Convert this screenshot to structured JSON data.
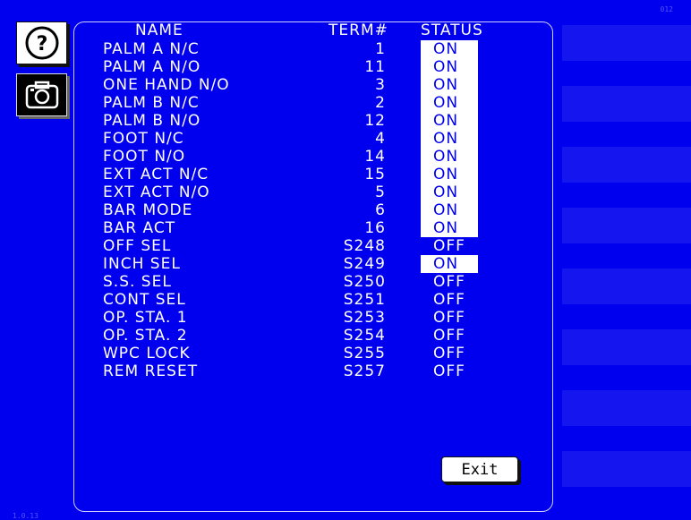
{
  "header": {
    "name": "NAME",
    "term": "TERM#",
    "status": "STATUS"
  },
  "rows": [
    {
      "name": "PALM A N/C",
      "term": "1",
      "status": "ON"
    },
    {
      "name": "PALM A N/O",
      "term": "11",
      "status": "ON"
    },
    {
      "name": "ONE HAND N/O",
      "term": "3",
      "status": "ON"
    },
    {
      "name": "PALM B N/C",
      "term": "2",
      "status": "ON"
    },
    {
      "name": "PALM B N/O",
      "term": "12",
      "status": "ON"
    },
    {
      "name": "FOOT N/C",
      "term": "4",
      "status": "ON"
    },
    {
      "name": "FOOT N/O",
      "term": "14",
      "status": "ON"
    },
    {
      "name": "EXT ACT N/C",
      "term": "15",
      "status": "ON"
    },
    {
      "name": "EXT ACT N/O",
      "term": "5",
      "status": "ON"
    },
    {
      "name": "BAR MODE",
      "term": "6",
      "status": "ON"
    },
    {
      "name": "BAR ACT",
      "term": "16",
      "status": "ON"
    },
    {
      "name": "OFF SEL",
      "term": "S248",
      "status": "OFF"
    },
    {
      "name": "INCH SEL",
      "term": "S249",
      "status": "ON"
    },
    {
      "name": "S.S. SEL",
      "term": "S250",
      "status": "OFF"
    },
    {
      "name": "CONT SEL",
      "term": "S251",
      "status": "OFF"
    },
    {
      "name": "OP. STA. 1",
      "term": "S253",
      "status": "OFF"
    },
    {
      "name": "OP. STA. 2",
      "term": "S254",
      "status": "OFF"
    },
    {
      "name": "WPC LOCK",
      "term": "S255",
      "status": "OFF"
    },
    {
      "name": "REM RESET",
      "term": "S257",
      "status": "OFF"
    }
  ],
  "buttons": {
    "exit": "Exit",
    "help_icon": "question-circle-icon",
    "camera_icon": "camera-icon"
  },
  "corner": {
    "top_right": "012",
    "bottom_left": "1.0.13"
  },
  "colors": {
    "background": "#0000ee",
    "text": "#ffffff",
    "on_highlight": "#ffffff"
  }
}
